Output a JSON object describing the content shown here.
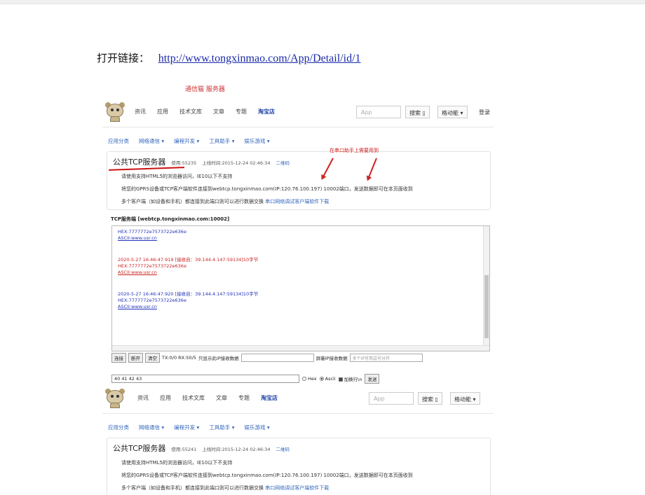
{
  "header": {
    "open_label": "打开链接：",
    "url": "http://www.tongxinmao.com/App/Detail/id/1"
  },
  "caption": "通信猫 服务器",
  "nav": {
    "items": [
      "资讯",
      "应用",
      "技术文库",
      "文章",
      "专题",
      "淘宝店"
    ],
    "search_placeholder": "App",
    "search_btn": "搜索 ▯",
    "dropdown": "格动能 ▾",
    "login": "登录"
  },
  "subnav": [
    "应用分类",
    "网络通信 ▾",
    "编程开发 ▾",
    "工具助手 ▾",
    "娱乐游戏 ▾"
  ],
  "shot1": {
    "title": "公共TCP服务器",
    "usage": "使用:55235",
    "online": "上线时间:2015-12-24 02:46:34",
    "qr": "二维码",
    "line1": "请使用支持HTML5的浏览器访问，IE10以下不支持",
    "line2": "将您的GPRS设备或TCP客户端软件连接到webtcp.tongxinmao.com(IP:120.76.100.197) 10002端口，发送数据即可在本页面收到",
    "line3": "多个客户端（如设备和手机）都连接到此端口则可以进行数据交换",
    "line3_link": "串口网络调试客户端软件下载",
    "arrow_note": "在串口助手上需要用到"
  },
  "tcp_title": "TCP服务端 [webtcp.tongxinmao.com:10002]",
  "log": [
    {
      "color": "blue",
      "lines": [
        "HEX:7777772e7573722e636e",
        "ASCII:www.usr.cn"
      ]
    },
    {
      "color": "red",
      "lines": [
        "2020-5-27 16:46:47:919 [接收自：39.144.4.147:59134]10字节",
        "HEX:7777772e7573722e636e",
        "ASCII:www.usr.cn"
      ]
    },
    {
      "color": "blue",
      "lines": [
        "2020-5-27 16:46:47:920 [接收自：39.144.4.147:59134]10字节",
        "HEX:7777772e7573722e636e",
        "ASCII:www.usr.cn"
      ]
    }
  ],
  "toolbar": {
    "connect": "连接",
    "disconnect": "断开",
    "clear": "清空",
    "stats": "TX:0/0 RX:50/5",
    "only_ip": "只显示此IP接收数据",
    "block_ip": "屏蔽IP接收数据",
    "block_placeholder": "多个IP可用逗号分开"
  },
  "send": {
    "value": "40 41 42 43",
    "hex": "Hex",
    "ascii": "Ascii",
    "newline": "加换行\\n",
    "send": "发送"
  },
  "shot2": {
    "title": "公共TCP服务器",
    "usage": "使用:55241",
    "online": "上线时间:2015-12-24 02:46:34",
    "qr": "二维码",
    "line1": "请使用支持HTML5的浏览器访问，IE10以下不支持",
    "line2": "将您的GPRS设备或TCP客户端软件连接到webtcp.tongxinmao.com(IP:120.76.100.197) 10002端口，发送数据即可在本页面收到",
    "line3": "多个客户端（如设备和手机）都连接到此端口则可以进行数据交换",
    "line3_link": "串口网络调试客户端软件下载"
  },
  "colors": {
    "link": "#1a2ba8",
    "annotation": "#d02020",
    "log_blue": "#2233bb",
    "log_red": "#cc2222"
  }
}
